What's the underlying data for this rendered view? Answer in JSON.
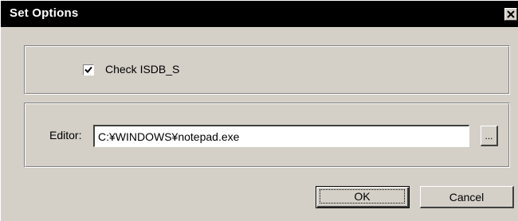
{
  "window": {
    "title": "Set Options"
  },
  "options": {
    "check_isdb_s": {
      "label": "Check  ISDB_S",
      "checked": true
    }
  },
  "editor": {
    "label": "Editor:",
    "value": "C:¥WINDOWS¥notepad.exe",
    "browse_label": "..."
  },
  "buttons": {
    "ok_label": "OK",
    "cancel_label": "Cancel"
  },
  "icons": {
    "close": "close-icon",
    "check": "checkmark-icon"
  },
  "colors": {
    "titlebar": "#000000",
    "dialog_face": "#d4d0c8"
  }
}
